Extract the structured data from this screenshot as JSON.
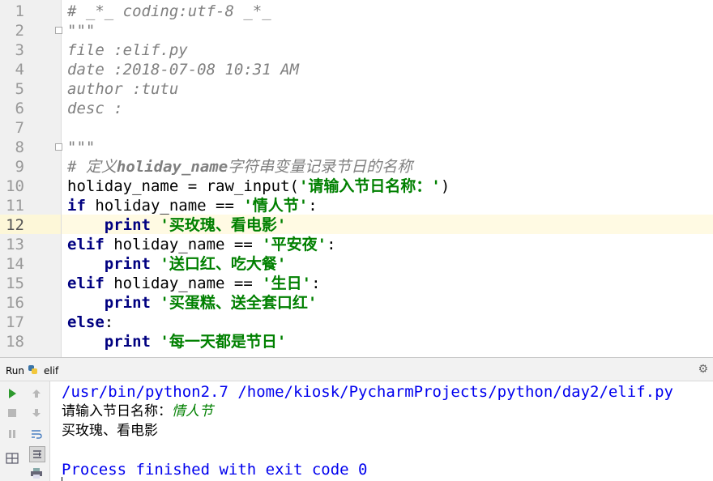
{
  "editor": {
    "lines": [
      {
        "n": "1",
        "parts": [
          {
            "t": "# _*_ coding:utf-8 _*_",
            "c": "cm"
          }
        ]
      },
      {
        "n": "2",
        "parts": [
          {
            "t": "\"\"\"",
            "c": "cm"
          }
        ]
      },
      {
        "n": "3",
        "parts": [
          {
            "t": "file :elif.py",
            "c": "cm"
          }
        ]
      },
      {
        "n": "4",
        "parts": [
          {
            "t": "date :2018-07-08 10:31 AM",
            "c": "cm"
          }
        ]
      },
      {
        "n": "5",
        "parts": [
          {
            "t": "author :tutu",
            "c": "cm"
          }
        ]
      },
      {
        "n": "6",
        "parts": [
          {
            "t": "desc :",
            "c": "cm"
          }
        ]
      },
      {
        "n": "7",
        "parts": []
      },
      {
        "n": "8",
        "parts": [
          {
            "t": "\"\"\"",
            "c": "cm"
          }
        ]
      },
      {
        "n": "9",
        "parts": [
          {
            "t": "# 定义",
            "c": "cm"
          },
          {
            "t": "holiday_name",
            "c": "cm-b"
          },
          {
            "t": "字符串变量记录节日的名称",
            "c": "cm"
          }
        ]
      },
      {
        "n": "10",
        "parts": [
          {
            "t": "holiday_name = raw_input(",
            "c": "nm"
          },
          {
            "t": "'请输入节日名称：'",
            "c": "st"
          },
          {
            "t": ")",
            "c": "nm"
          }
        ]
      },
      {
        "n": "11",
        "parts": [
          {
            "t": "if",
            "c": "kw"
          },
          {
            "t": " holiday_name == ",
            "c": "nm"
          },
          {
            "t": "'情人节'",
            "c": "st"
          },
          {
            "t": ":",
            "c": "nm"
          }
        ]
      },
      {
        "n": "12",
        "parts": [
          {
            "t": "    ",
            "c": "nm"
          },
          {
            "t": "print",
            "c": "kw"
          },
          {
            "t": " ",
            "c": "nm"
          },
          {
            "t": "'买玫瑰、看电影'",
            "c": "st"
          }
        ]
      },
      {
        "n": "13",
        "parts": [
          {
            "t": "elif",
            "c": "kw"
          },
          {
            "t": " holiday_name == ",
            "c": "nm"
          },
          {
            "t": "'平安夜'",
            "c": "st"
          },
          {
            "t": ":",
            "c": "nm"
          }
        ]
      },
      {
        "n": "14",
        "parts": [
          {
            "t": "    ",
            "c": "nm"
          },
          {
            "t": "print",
            "c": "kw"
          },
          {
            "t": " ",
            "c": "nm"
          },
          {
            "t": "'送口红、吃大餐'",
            "c": "st"
          }
        ]
      },
      {
        "n": "15",
        "parts": [
          {
            "t": "elif",
            "c": "kw"
          },
          {
            "t": " holiday_name == ",
            "c": "nm"
          },
          {
            "t": "'生日'",
            "c": "st"
          },
          {
            "t": ":",
            "c": "nm"
          }
        ]
      },
      {
        "n": "16",
        "parts": [
          {
            "t": "    ",
            "c": "nm"
          },
          {
            "t": "print",
            "c": "kw"
          },
          {
            "t": " ",
            "c": "nm"
          },
          {
            "t": "'买蛋糕、送全套口红'",
            "c": "st"
          }
        ]
      },
      {
        "n": "17",
        "parts": [
          {
            "t": "else",
            "c": "kw"
          },
          {
            "t": ":",
            "c": "nm"
          }
        ]
      },
      {
        "n": "18",
        "parts": [
          {
            "t": "    ",
            "c": "nm"
          },
          {
            "t": "print",
            "c": "kw"
          },
          {
            "t": " ",
            "c": "nm"
          },
          {
            "t": "'每一天都是节日'",
            "c": "st"
          }
        ]
      }
    ],
    "current_line": "12"
  },
  "run_panel": {
    "label": "Run",
    "tab_name": "elif",
    "console": {
      "command": "/usr/bin/python2.7 /home/kiosk/PycharmProjects/python/day2/elif.py",
      "prompt": "请输入节日名称：",
      "user_input": "情人节",
      "output": "买玫瑰、看电影",
      "exit_message": "Process finished with exit code 0"
    }
  },
  "colors": {
    "keyword": "#000080",
    "string": "#008000",
    "comment": "#808080",
    "console_path": "#0000ee"
  },
  "icons": [
    "python-file-icon",
    "gear-icon",
    "run-icon",
    "stop-icon",
    "pause-icon",
    "up-arrow-icon",
    "down-arrow-icon",
    "soft-wrap-icon",
    "scroll-to-end-icon",
    "layout-icon",
    "print-icon"
  ]
}
